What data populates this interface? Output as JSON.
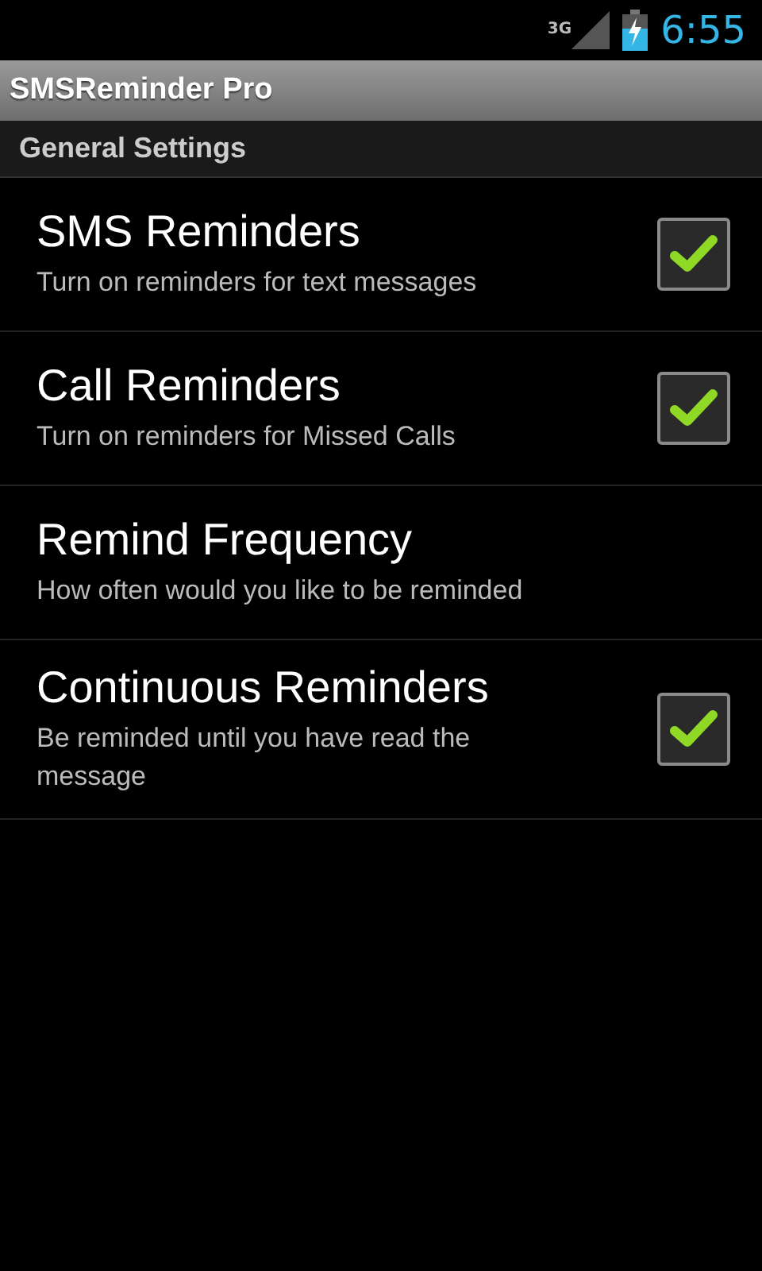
{
  "status_bar": {
    "network": "3G",
    "time": "6:55"
  },
  "title_bar": {
    "title": "SMSReminder Pro"
  },
  "section": {
    "title": "General Settings"
  },
  "settings": [
    {
      "kind": "checkbox",
      "title": "SMS Reminders",
      "summary": "Turn on reminders for text messages",
      "checked": true
    },
    {
      "kind": "checkbox",
      "title": "Call Reminders",
      "summary": "Turn on reminders for Missed Calls",
      "checked": true
    },
    {
      "kind": "plain",
      "title": "Remind Frequency",
      "summary": "How often would you like to be reminded"
    },
    {
      "kind": "checkbox",
      "title": "Continuous Reminders",
      "summary": "Be reminded until you have read the message",
      "checked": true
    }
  ]
}
